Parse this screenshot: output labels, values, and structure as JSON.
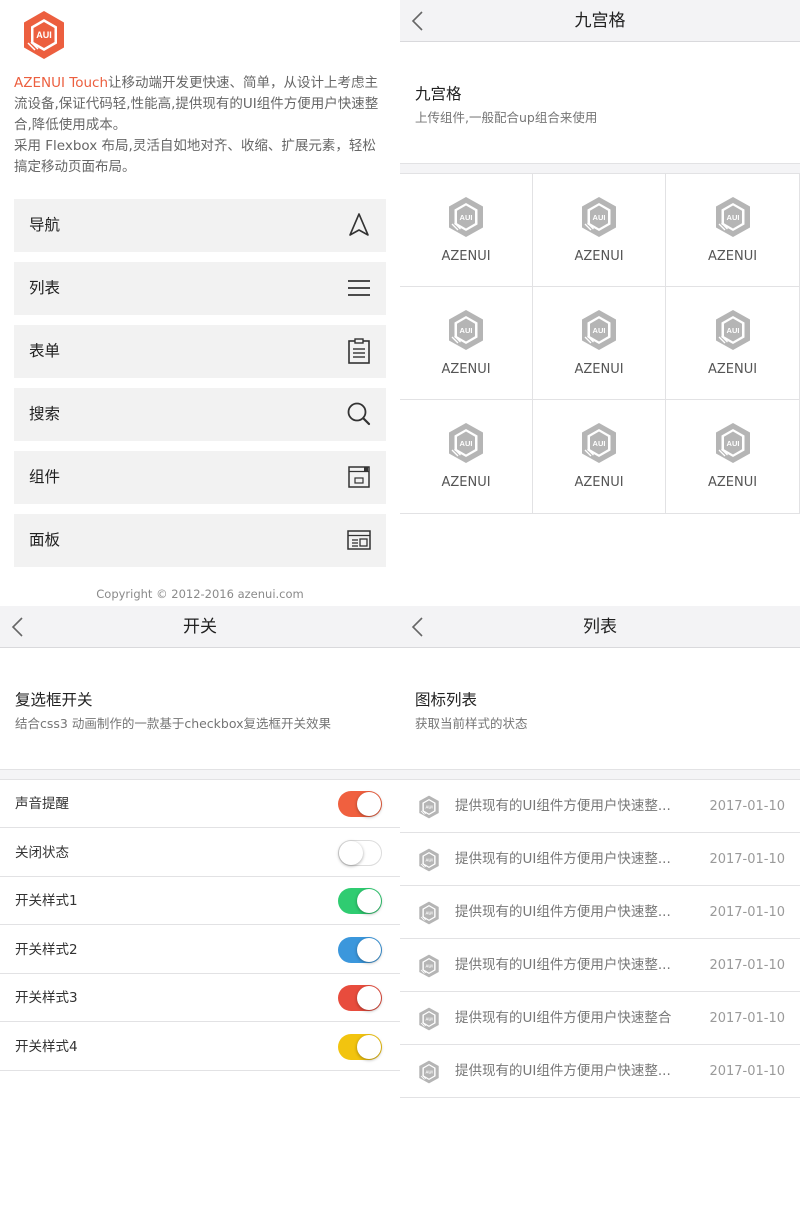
{
  "home": {
    "logo_text": "AUI",
    "intro_brand": "AZENUI Touch",
    "intro_rest": "让移动端开发更快速、简单，从设计上考虑主流设备,保证代码轻,性能高,提供现有的UI组件方便用户快速整合,降低使用成本。",
    "intro_line2": "采用 Flexbox 布局,灵活自如地对齐、收缩、扩展元素，轻松搞定移动页面布局。",
    "menu": [
      {
        "label": "导航",
        "icon": "navigation-arrow-icon"
      },
      {
        "label": "列表",
        "icon": "list-lines-icon"
      },
      {
        "label": "表单",
        "icon": "clipboard-form-icon"
      },
      {
        "label": "搜索",
        "icon": "search-icon"
      },
      {
        "label": "组件",
        "icon": "window-component-icon"
      },
      {
        "label": "面板",
        "icon": "panel-icon"
      }
    ],
    "copyright": "Copyright © 2012-2016 azenui.com"
  },
  "grid_page": {
    "title": "九宫格",
    "heading": "九宫格",
    "subtitle": "上传组件,一般配合up组合来使用",
    "items": [
      {
        "label": "AZENUI",
        "icon_text": "AUI"
      },
      {
        "label": "AZENUI",
        "icon_text": "AUI"
      },
      {
        "label": "AZENUI",
        "icon_text": "AUI"
      },
      {
        "label": "AZENUI",
        "icon_text": "AUI"
      },
      {
        "label": "AZENUI",
        "icon_text": "AUI"
      },
      {
        "label": "AZENUI",
        "icon_text": "AUI"
      },
      {
        "label": "AZENUI",
        "icon_text": "AUI"
      },
      {
        "label": "AZENUI",
        "icon_text": "AUI"
      },
      {
        "label": "AZENUI",
        "icon_text": "AUI"
      }
    ]
  },
  "switch_page": {
    "title": "开关",
    "heading": "复选框开关",
    "subtitle": "结合css3 动画制作的一款基于checkbox复选框开关效果",
    "rows": [
      {
        "label": "声音提醒",
        "on": true,
        "color": "#f0603f"
      },
      {
        "label": "关闭状态",
        "on": false,
        "color": "#ffffff"
      },
      {
        "label": "开关样式1",
        "on": true,
        "color": "#2fcc71"
      },
      {
        "label": "开关样式2",
        "on": true,
        "color": "#3b97dc"
      },
      {
        "label": "开关样式3",
        "on": true,
        "color": "#e84c3d"
      },
      {
        "label": "开关样式4",
        "on": true,
        "color": "#f2c40f"
      }
    ]
  },
  "list_page": {
    "title": "列表",
    "heading": "图标列表",
    "subtitle": "获取当前样式的状态",
    "items": [
      {
        "text": "提供现有的UI组件方便用户快速整...",
        "date": "2017-01-10",
        "icon_text": "AUI"
      },
      {
        "text": "提供现有的UI组件方便用户快速整...",
        "date": "2017-01-10",
        "icon_text": "AUI"
      },
      {
        "text": "提供现有的UI组件方便用户快速整...",
        "date": "2017-01-10",
        "icon_text": "AUI"
      },
      {
        "text": "提供现有的UI组件方便用户快速整...",
        "date": "2017-01-10",
        "icon_text": "AUI"
      },
      {
        "text": "提供现有的UI组件方便用户快速整合",
        "date": "2017-01-10",
        "icon_text": "AUI"
      },
      {
        "text": "提供现有的UI组件方便用户快速整...",
        "date": "2017-01-10",
        "icon_text": "AUI"
      }
    ]
  },
  "colors": {
    "brand": "#ec5f3f",
    "bar_bg": "#f3f3f5",
    "menu_bg": "#f2f2f2",
    "logo_gray": "#b5b5b5"
  }
}
